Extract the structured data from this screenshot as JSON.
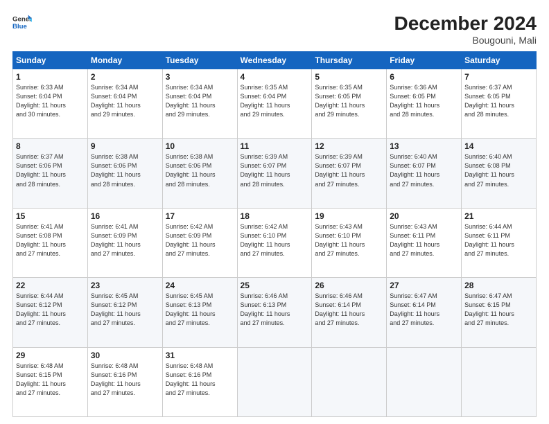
{
  "header": {
    "logo_general": "General",
    "logo_blue": "Blue",
    "month": "December 2024",
    "location": "Bougouni, Mali"
  },
  "weekdays": [
    "Sunday",
    "Monday",
    "Tuesday",
    "Wednesday",
    "Thursday",
    "Friday",
    "Saturday"
  ],
  "weeks": [
    [
      {
        "day": "1",
        "info": "Sunrise: 6:33 AM\nSunset: 6:04 PM\nDaylight: 11 hours\nand 30 minutes."
      },
      {
        "day": "2",
        "info": "Sunrise: 6:34 AM\nSunset: 6:04 PM\nDaylight: 11 hours\nand 29 minutes."
      },
      {
        "day": "3",
        "info": "Sunrise: 6:34 AM\nSunset: 6:04 PM\nDaylight: 11 hours\nand 29 minutes."
      },
      {
        "day": "4",
        "info": "Sunrise: 6:35 AM\nSunset: 6:04 PM\nDaylight: 11 hours\nand 29 minutes."
      },
      {
        "day": "5",
        "info": "Sunrise: 6:35 AM\nSunset: 6:05 PM\nDaylight: 11 hours\nand 29 minutes."
      },
      {
        "day": "6",
        "info": "Sunrise: 6:36 AM\nSunset: 6:05 PM\nDaylight: 11 hours\nand 28 minutes."
      },
      {
        "day": "7",
        "info": "Sunrise: 6:37 AM\nSunset: 6:05 PM\nDaylight: 11 hours\nand 28 minutes."
      }
    ],
    [
      {
        "day": "8",
        "info": "Sunrise: 6:37 AM\nSunset: 6:06 PM\nDaylight: 11 hours\nand 28 minutes."
      },
      {
        "day": "9",
        "info": "Sunrise: 6:38 AM\nSunset: 6:06 PM\nDaylight: 11 hours\nand 28 minutes."
      },
      {
        "day": "10",
        "info": "Sunrise: 6:38 AM\nSunset: 6:06 PM\nDaylight: 11 hours\nand 28 minutes."
      },
      {
        "day": "11",
        "info": "Sunrise: 6:39 AM\nSunset: 6:07 PM\nDaylight: 11 hours\nand 28 minutes."
      },
      {
        "day": "12",
        "info": "Sunrise: 6:39 AM\nSunset: 6:07 PM\nDaylight: 11 hours\nand 27 minutes."
      },
      {
        "day": "13",
        "info": "Sunrise: 6:40 AM\nSunset: 6:07 PM\nDaylight: 11 hours\nand 27 minutes."
      },
      {
        "day": "14",
        "info": "Sunrise: 6:40 AM\nSunset: 6:08 PM\nDaylight: 11 hours\nand 27 minutes."
      }
    ],
    [
      {
        "day": "15",
        "info": "Sunrise: 6:41 AM\nSunset: 6:08 PM\nDaylight: 11 hours\nand 27 minutes."
      },
      {
        "day": "16",
        "info": "Sunrise: 6:41 AM\nSunset: 6:09 PM\nDaylight: 11 hours\nand 27 minutes."
      },
      {
        "day": "17",
        "info": "Sunrise: 6:42 AM\nSunset: 6:09 PM\nDaylight: 11 hours\nand 27 minutes."
      },
      {
        "day": "18",
        "info": "Sunrise: 6:42 AM\nSunset: 6:10 PM\nDaylight: 11 hours\nand 27 minutes."
      },
      {
        "day": "19",
        "info": "Sunrise: 6:43 AM\nSunset: 6:10 PM\nDaylight: 11 hours\nand 27 minutes."
      },
      {
        "day": "20",
        "info": "Sunrise: 6:43 AM\nSunset: 6:11 PM\nDaylight: 11 hours\nand 27 minutes."
      },
      {
        "day": "21",
        "info": "Sunrise: 6:44 AM\nSunset: 6:11 PM\nDaylight: 11 hours\nand 27 minutes."
      }
    ],
    [
      {
        "day": "22",
        "info": "Sunrise: 6:44 AM\nSunset: 6:12 PM\nDaylight: 11 hours\nand 27 minutes."
      },
      {
        "day": "23",
        "info": "Sunrise: 6:45 AM\nSunset: 6:12 PM\nDaylight: 11 hours\nand 27 minutes."
      },
      {
        "day": "24",
        "info": "Sunrise: 6:45 AM\nSunset: 6:13 PM\nDaylight: 11 hours\nand 27 minutes."
      },
      {
        "day": "25",
        "info": "Sunrise: 6:46 AM\nSunset: 6:13 PM\nDaylight: 11 hours\nand 27 minutes."
      },
      {
        "day": "26",
        "info": "Sunrise: 6:46 AM\nSunset: 6:14 PM\nDaylight: 11 hours\nand 27 minutes."
      },
      {
        "day": "27",
        "info": "Sunrise: 6:47 AM\nSunset: 6:14 PM\nDaylight: 11 hours\nand 27 minutes."
      },
      {
        "day": "28",
        "info": "Sunrise: 6:47 AM\nSunset: 6:15 PM\nDaylight: 11 hours\nand 27 minutes."
      }
    ],
    [
      {
        "day": "29",
        "info": "Sunrise: 6:48 AM\nSunset: 6:15 PM\nDaylight: 11 hours\nand 27 minutes."
      },
      {
        "day": "30",
        "info": "Sunrise: 6:48 AM\nSunset: 6:16 PM\nDaylight: 11 hours\nand 27 minutes."
      },
      {
        "day": "31",
        "info": "Sunrise: 6:48 AM\nSunset: 6:16 PM\nDaylight: 11 hours\nand 27 minutes."
      },
      {
        "day": "",
        "info": ""
      },
      {
        "day": "",
        "info": ""
      },
      {
        "day": "",
        "info": ""
      },
      {
        "day": "",
        "info": ""
      }
    ]
  ]
}
